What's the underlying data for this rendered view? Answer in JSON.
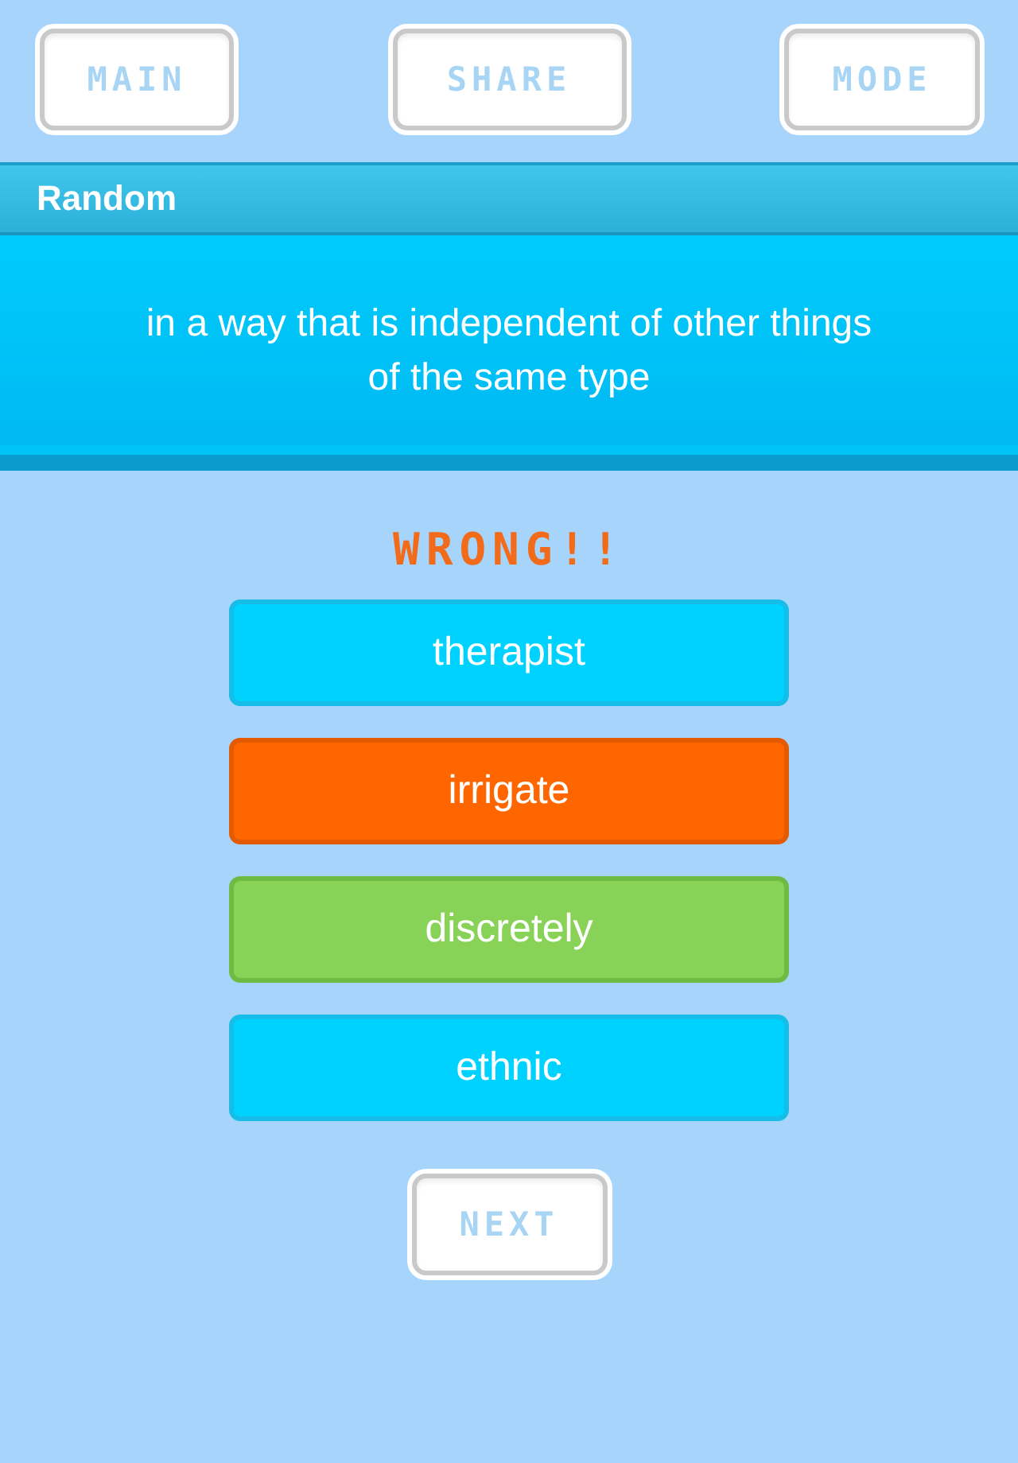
{
  "nav": [
    {
      "label": "MAIN"
    },
    {
      "label": "SHARE"
    },
    {
      "label": "MODE"
    }
  ],
  "word": {
    "title": "Random",
    "definition": "in a way that is independent of other things of the same type"
  },
  "feedback": "WRONG!!",
  "answers": [
    {
      "label": "therapist",
      "selected": false,
      "correct": false
    },
    {
      "label": "irrigate",
      "selected": true,
      "correct": false
    },
    {
      "label": "discretely",
      "selected": false,
      "correct": true
    },
    {
      "label": "ethnic",
      "selected": false,
      "correct": false
    }
  ],
  "next": {
    "label": "NEXT"
  }
}
